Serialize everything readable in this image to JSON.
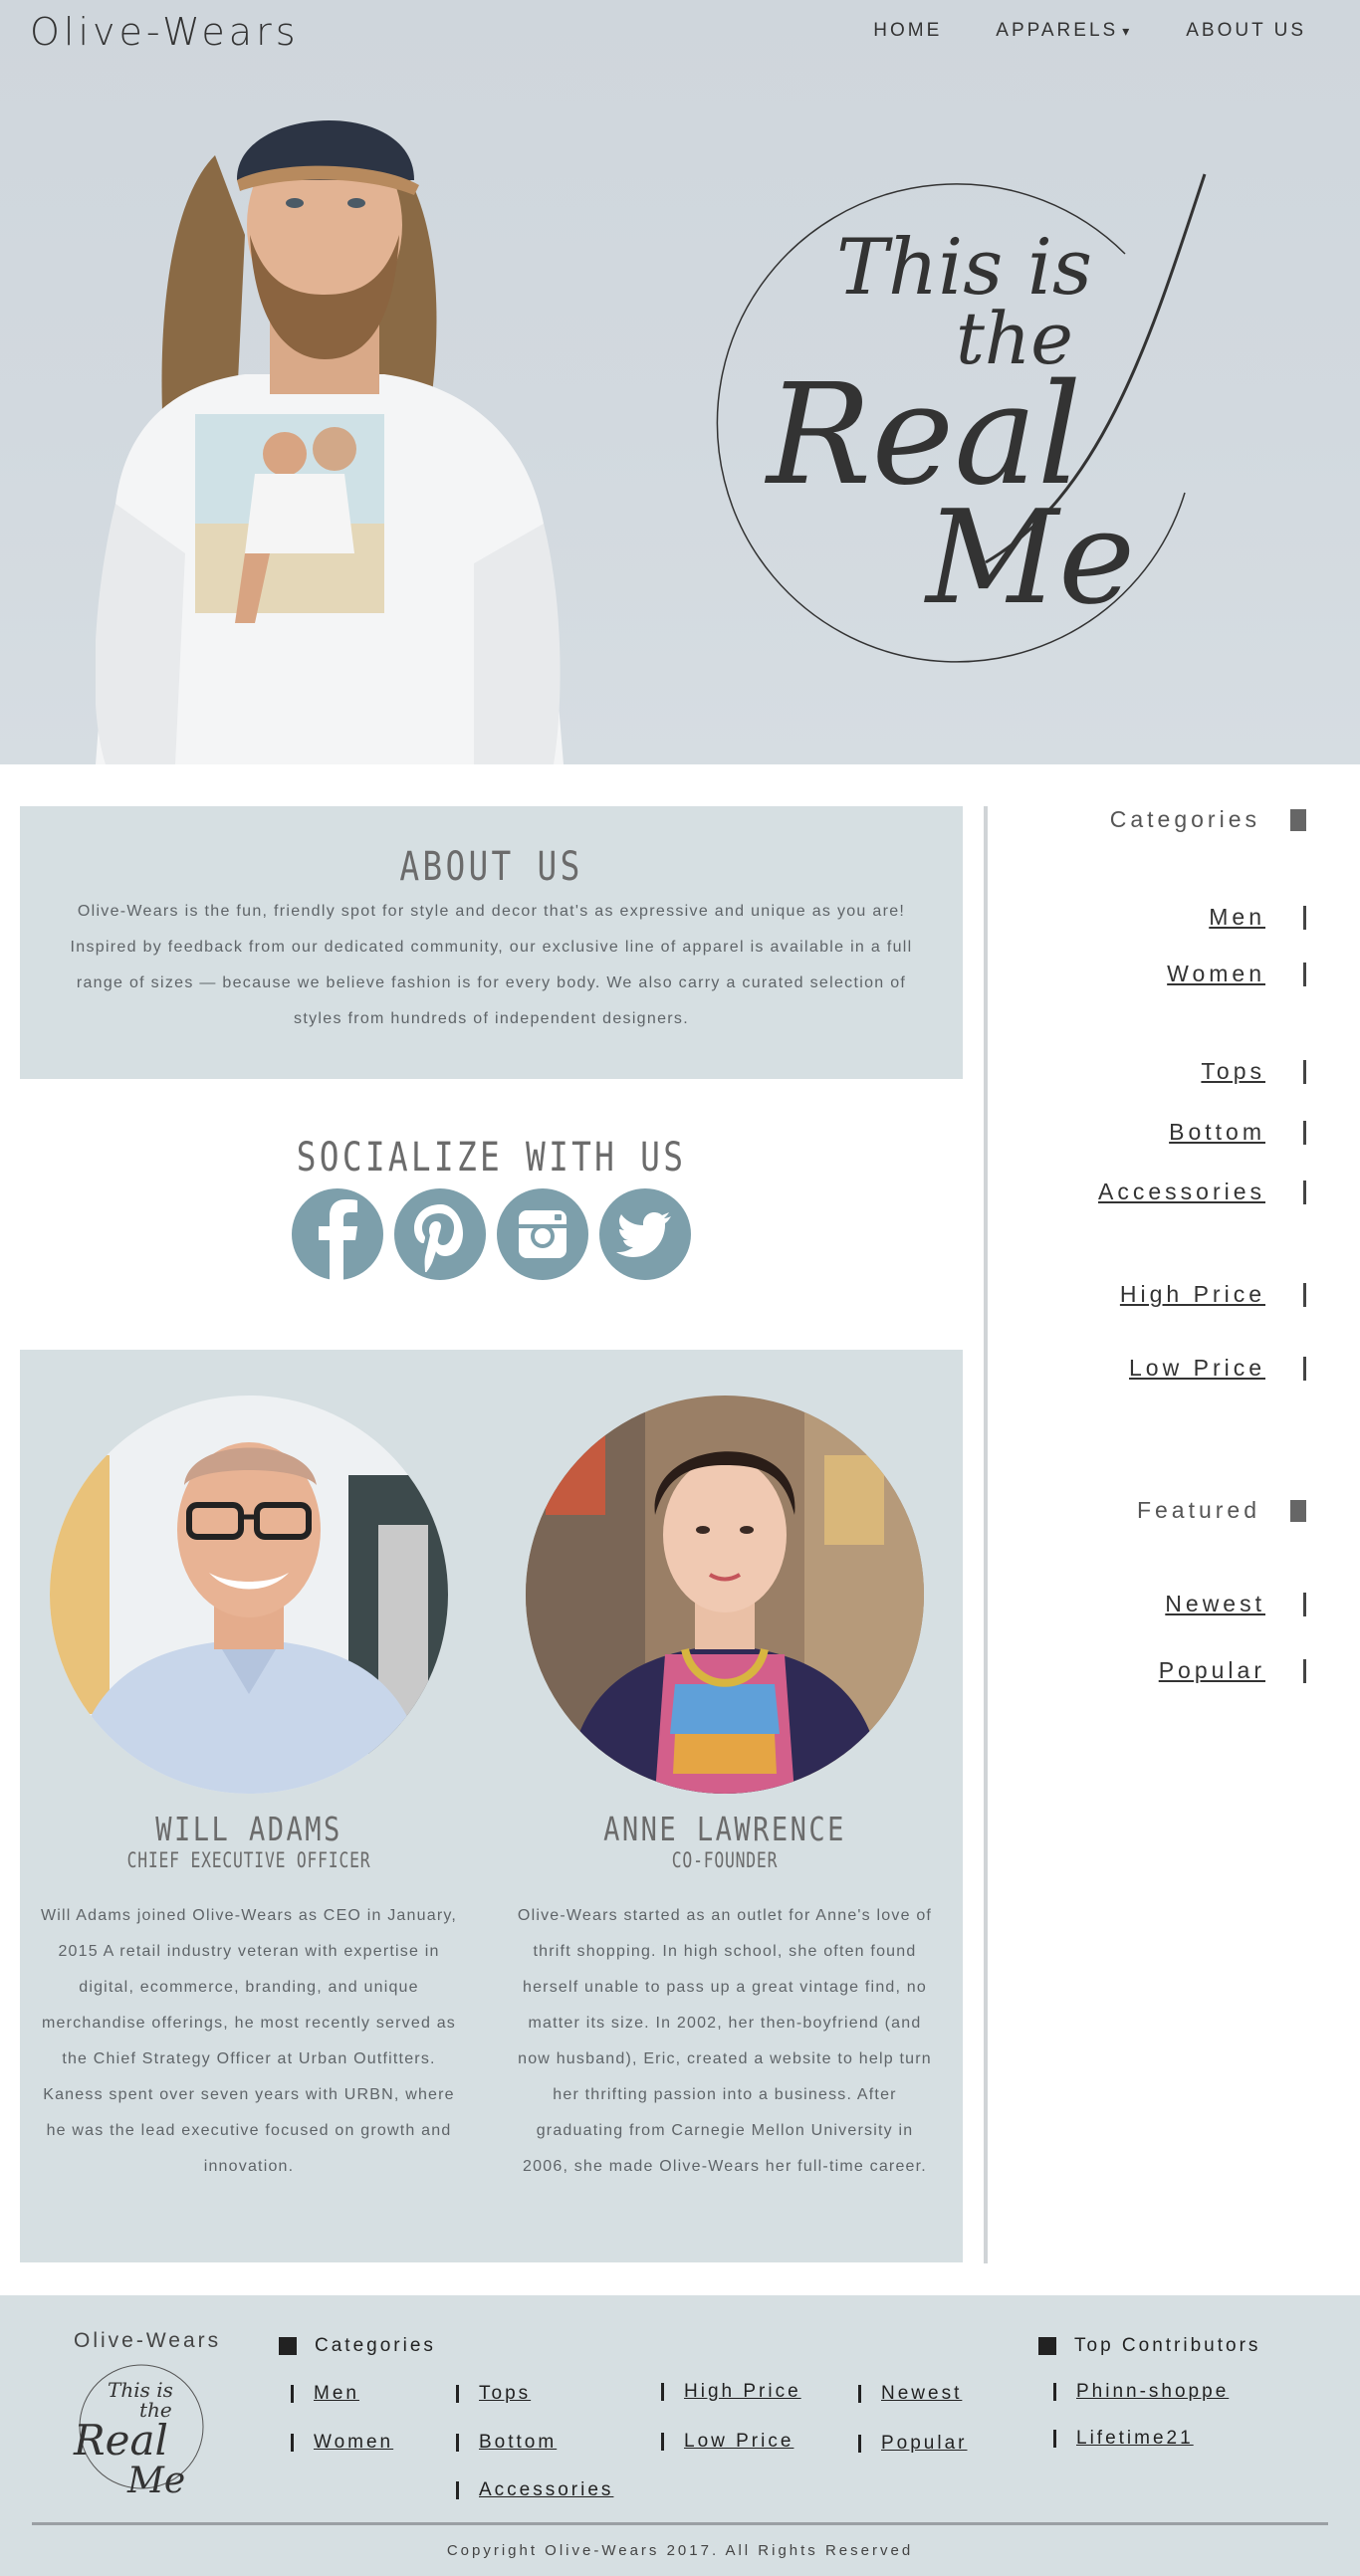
{
  "header": {
    "brand": "Olive-Wears",
    "nav": [
      {
        "label": "HOME"
      },
      {
        "label": "APPARELS",
        "caret": "▾"
      },
      {
        "label": "ABOUT US"
      }
    ]
  },
  "hero": {
    "tagline_line1": "This is",
    "tagline_line2": "the",
    "tagline_line3": "Real",
    "tagline_line4": "Me"
  },
  "about": {
    "title": "ABOUT US",
    "body": "Olive-Wears is the fun, friendly spot for style and decor that's as expressive and unique as you are! Inspired by feedback from our dedicated community, our exclusive line of apparel is available in a full range of sizes — because we believe fashion is for every body. We also carry a curated selection of styles from hundreds of independent designers."
  },
  "social": {
    "title": "SOCIALIZE WITH US",
    "icons": [
      "facebook-icon",
      "pinterest-icon",
      "instagram-icon",
      "twitter-icon"
    ]
  },
  "team": [
    {
      "name": "WILL ADAMS",
      "role": "CHIEF EXECUTIVE OFFICER",
      "bio": "Will Adams joined Olive-Wears as CEO in January, 2015 A retail industry veteran with expertise in digital, ecommerce, branding, and unique merchandise offerings, he most recently served as the Chief Strategy Officer at Urban Outfitters. Kaness spent over seven years with URBN, where he was the lead executive focused on growth and innovation."
    },
    {
      "name": "ANNE LAWRENCE",
      "role": "CO-FOUNDER",
      "bio": "Olive-Wears started as an outlet for Anne's love of thrift shopping. In high school, she often found herself unable to pass up a great vintage find, no matter its size. In 2002, her then-boyfriend (and now husband), Eric, created a website to help turn her thrifting passion into a business. After graduating from Carnegie Mellon University in 2006, she made Olive-Wears her full-time career."
    }
  ],
  "sidebar": {
    "categories_title": "Categories",
    "categories": [
      "Men",
      "Women",
      "Tops",
      "Bottom",
      "Accessories",
      "High Price",
      "Low Price"
    ],
    "featured_title": "Featured",
    "featured": [
      "Newest",
      "Popular"
    ]
  },
  "footer": {
    "brand": "Olive-Wears",
    "categories_title": "Categories",
    "col1": [
      "Men",
      "Women"
    ],
    "col2": [
      "Tops",
      "Bottom",
      "Accessories"
    ],
    "col3": [
      "High Price",
      "Low Price"
    ],
    "col4": [
      "Newest",
      "Popular"
    ],
    "contributors_title": "Top Contributors",
    "contributors": [
      "Phinn-shoppe",
      "Lifetime21"
    ],
    "copyright": "Copyright Olive-Wears 2017. All Rights Reserved"
  },
  "colors": {
    "hero_bg": "#d2d9df",
    "panel_bg": "#d6dfe2",
    "social_icon": "#7d9fab",
    "text_dark": "#333333"
  }
}
